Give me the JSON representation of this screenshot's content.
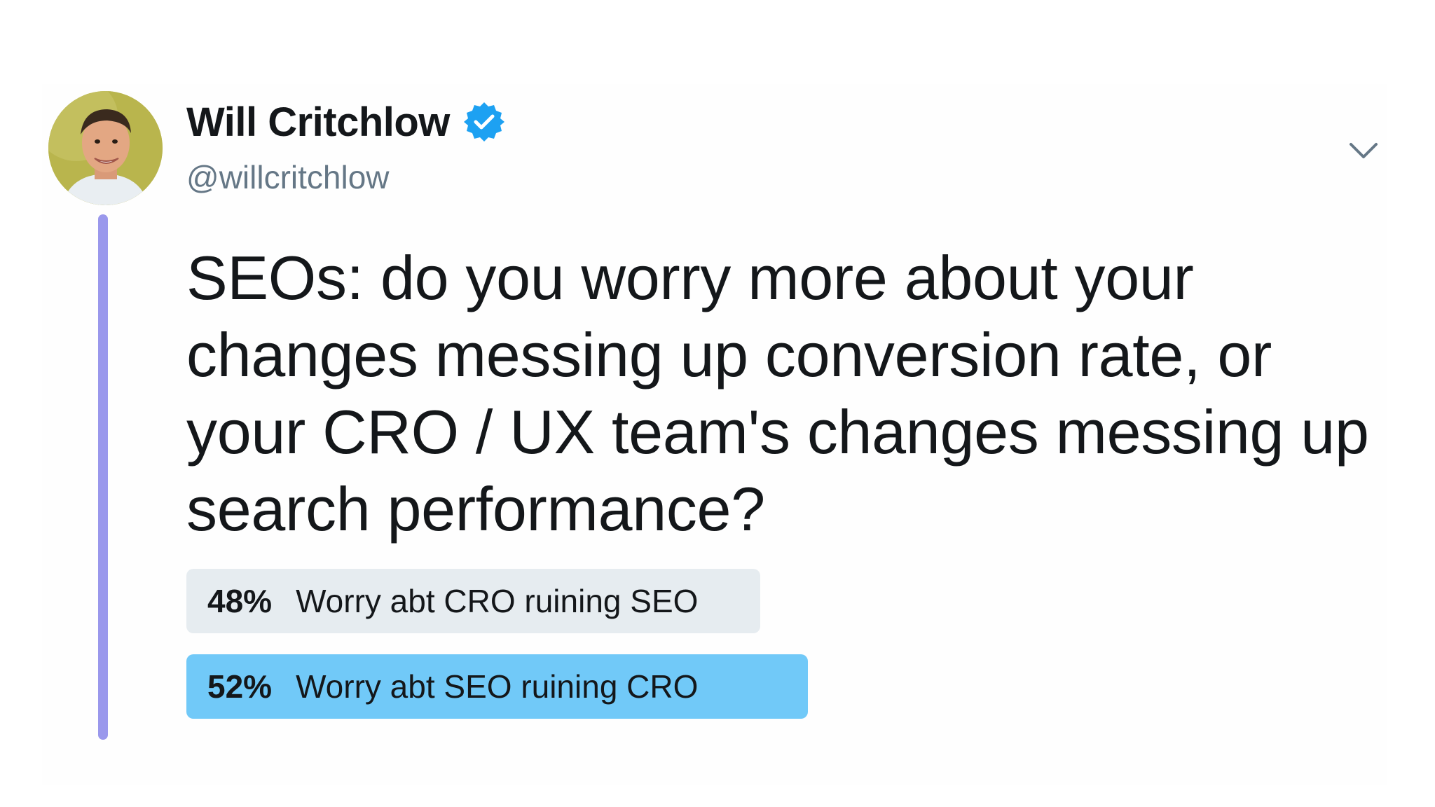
{
  "author": {
    "display_name": "Will Critchlow",
    "handle": "@willcritchlow",
    "verified": true,
    "avatar_icon": "avatar-photo"
  },
  "tweet": {
    "text": "SEOs: do you worry more about your changes messing up conversion rate, or your CRO / UX team's changes messing up search performance?"
  },
  "poll": {
    "options": [
      {
        "percent": "48%",
        "label": "Worry abt CRO ruining SEO",
        "share": 0.48,
        "winner": false
      },
      {
        "percent": "52%",
        "label": "Worry abt SEO ruining CRO",
        "share": 0.52,
        "winner": true
      }
    ]
  },
  "icons": {
    "verified": "verified-badge-icon",
    "menu": "chevron-down-icon"
  },
  "colors": {
    "verified_blue": "#1da1f2",
    "poll_winner": "#71c9f8",
    "poll_loser": "#e6ecf0",
    "thread_line": "#9a98ec",
    "handle_gray": "#657786"
  }
}
